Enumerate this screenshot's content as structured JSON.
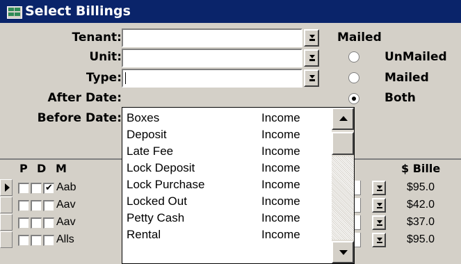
{
  "window": {
    "title": "Select Billings"
  },
  "filters": {
    "tenant_label": "Tenant:",
    "unit_label": "Unit:",
    "type_label": "Type:",
    "after_date_label": "After Date:",
    "before_date_label": "Before Date:",
    "tenant_value": "",
    "unit_value": "",
    "type_value": ""
  },
  "mailed": {
    "label": "Mailed",
    "options": [
      "UnMailed",
      "Mailed",
      "Both"
    ],
    "selected": "Both"
  },
  "grid": {
    "headers": {
      "p": "P",
      "d": "D",
      "m": "M",
      "billed": "$ Bille"
    },
    "rows": [
      {
        "name": "Aab",
        "billed": "$95.0",
        "m_checked": true,
        "current": true
      },
      {
        "name": "Aav",
        "billed": "$42.0",
        "m_checked": false,
        "current": false
      },
      {
        "name": "Aav",
        "billed": "$37.0",
        "m_checked": false,
        "current": false
      },
      {
        "name": "Alls",
        "billed": "$95.0",
        "m_checked": false,
        "current": false
      }
    ]
  },
  "type_dropdown": {
    "items": [
      {
        "name": "Boxes",
        "category": "Income"
      },
      {
        "name": "Deposit",
        "category": "Income"
      },
      {
        "name": "Late Fee",
        "category": "Income"
      },
      {
        "name": "Lock Deposit",
        "category": "Income"
      },
      {
        "name": "Lock Purchase",
        "category": "Income"
      },
      {
        "name": "Locked Out",
        "category": "Income"
      },
      {
        "name": "Petty Cash",
        "category": "Income"
      },
      {
        "name": "Rental",
        "category": "Income"
      }
    ]
  },
  "colors": {
    "titlebar": "#0a246a",
    "face": "#d4d0c8"
  }
}
